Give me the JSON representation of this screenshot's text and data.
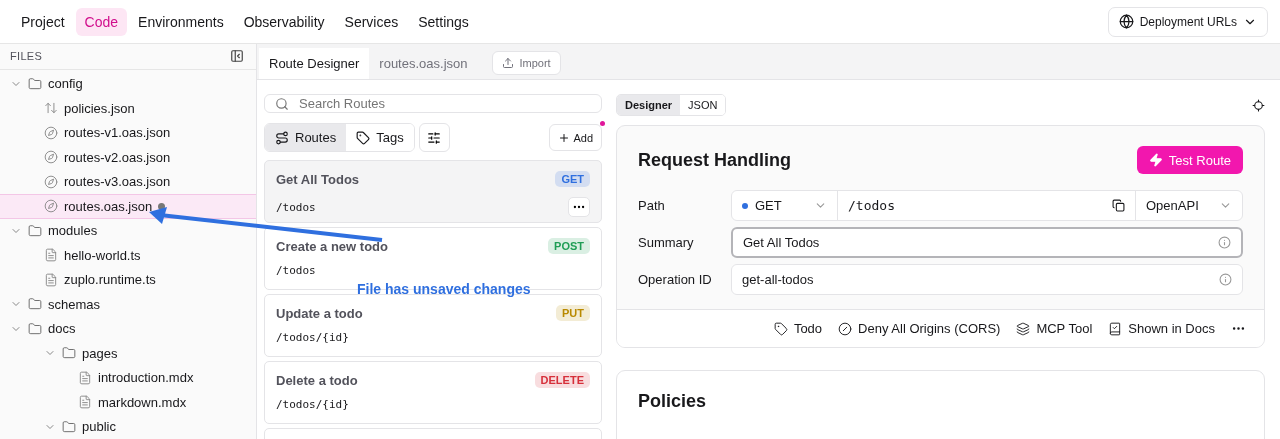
{
  "nav": {
    "tabs": [
      {
        "label": "Project",
        "selected": false
      },
      {
        "label": "Code",
        "selected": true
      },
      {
        "label": "Environments",
        "selected": false
      },
      {
        "label": "Observability",
        "selected": false
      },
      {
        "label": "Services",
        "selected": false
      },
      {
        "label": "Settings",
        "selected": false
      }
    ],
    "deploy_button": "Deployment URLs"
  },
  "sidebar": {
    "title": "FILES",
    "tree": [
      {
        "kind": "folder",
        "label": "config",
        "expanded": true,
        "children": [
          {
            "kind": "policy",
            "label": "policies.json",
            "selected": false,
            "unsaved": false
          },
          {
            "kind": "route",
            "label": "routes-v1.oas.json",
            "selected": false,
            "unsaved": false
          },
          {
            "kind": "route",
            "label": "routes-v2.oas.json",
            "selected": false,
            "unsaved": false
          },
          {
            "kind": "route",
            "label": "routes-v3.oas.json",
            "selected": false,
            "unsaved": false
          },
          {
            "kind": "route",
            "label": "routes.oas.json",
            "selected": true,
            "unsaved": true
          }
        ]
      },
      {
        "kind": "folder",
        "label": "modules",
        "expanded": true,
        "children": [
          {
            "kind": "file",
            "label": "hello-world.ts",
            "selected": false,
            "unsaved": false
          },
          {
            "kind": "file",
            "label": "zuplo.runtime.ts",
            "selected": false,
            "unsaved": false
          }
        ]
      },
      {
        "kind": "folder",
        "label": "schemas",
        "expanded": true
      },
      {
        "kind": "folder",
        "label": "docs",
        "expanded": true,
        "children": [
          {
            "kind": "folder",
            "label": "pages",
            "expanded": true,
            "children": [
              {
                "kind": "file",
                "label": "introduction.mdx",
                "selected": false,
                "unsaved": false
              },
              {
                "kind": "file",
                "label": "markdown.mdx",
                "selected": false,
                "unsaved": false
              }
            ]
          },
          {
            "kind": "folder",
            "label": "public",
            "expanded": true
          }
        ]
      }
    ]
  },
  "editor_tabs": [
    {
      "label": "Route Designer",
      "selected": true
    },
    {
      "label": "routes.oas.json",
      "selected": false
    }
  ],
  "import_button": "Import",
  "routes": {
    "search_placeholder": "Search Routes",
    "view_tabs": [
      {
        "label": "Routes",
        "selected": true
      },
      {
        "label": "Tags",
        "selected": false
      }
    ],
    "add_button": "Add",
    "items": [
      {
        "name": "Get All Todos",
        "path": "/todos",
        "method": "GET",
        "color": "#2f6fdf",
        "selected": true
      },
      {
        "name": "Create a new todo",
        "path": "/todos",
        "method": "POST",
        "color": "#1f9d55",
        "selected": false
      },
      {
        "name": "Update a todo",
        "path": "/todos/{id}",
        "method": "PUT",
        "color": "#b98900",
        "selected": false
      },
      {
        "name": "Delete a todo",
        "path": "/todos/{id}",
        "method": "DELETE",
        "color": "#d62f3a",
        "selected": false
      }
    ]
  },
  "mode_tabs": [
    {
      "label": "Designer",
      "selected": true
    },
    {
      "label": "JSON",
      "selected": false
    }
  ],
  "request": {
    "title": "Request Handling",
    "test_button": "Test Route",
    "path_label": "Path",
    "method": "GET",
    "path": "/todos",
    "spec": "OpenAPI",
    "fields": [
      {
        "label": "Summary",
        "value": "Get All Todos",
        "focused": true
      },
      {
        "label": "Operation ID",
        "value": "get-all-todos",
        "focused": false
      }
    ],
    "footer": [
      {
        "kind": "tag",
        "label": "Todo"
      },
      {
        "kind": "cors",
        "label": "Deny All Origins (CORS)"
      },
      {
        "kind": "mcp",
        "label": "MCP Tool"
      },
      {
        "kind": "docs",
        "label": "Shown in Docs"
      }
    ]
  },
  "policies": {
    "title": "Policies"
  },
  "annotation": "File has unsaved changes"
}
